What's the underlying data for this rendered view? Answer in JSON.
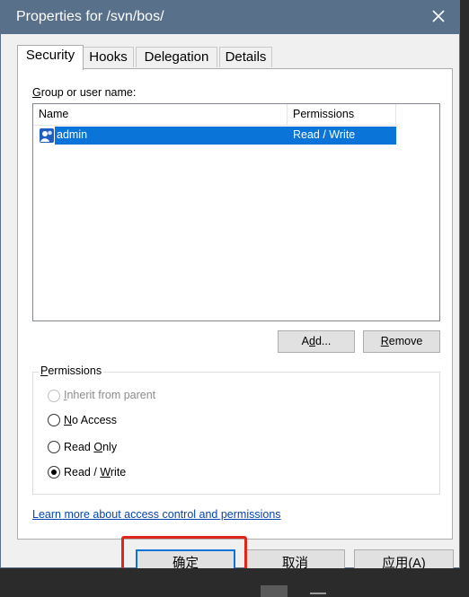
{
  "window": {
    "title": "Properties for /svn/bos/"
  },
  "tabs": [
    {
      "label": "Security",
      "active": true
    },
    {
      "label": "Hooks",
      "active": false
    },
    {
      "label": "Delegation",
      "active": false
    },
    {
      "label": "Details",
      "active": false
    }
  ],
  "security": {
    "group_label_prefix": "",
    "group_label_u": "G",
    "group_label_rest": "roup or user name:",
    "columns": [
      "Name",
      "Permissions"
    ],
    "rows": [
      {
        "name": "admin",
        "permission": "Read / Write",
        "selected": true
      }
    ],
    "add_button": {
      "prefix": "A",
      "u": "d",
      "rest": "d..."
    },
    "remove_button": {
      "prefix": "",
      "u": "R",
      "rest": "emove"
    },
    "permissions_group": {
      "u": "P",
      "rest": "ermissions"
    },
    "options": [
      {
        "prefix": "",
        "u": "I",
        "rest": "nherit from parent",
        "checked": false,
        "disabled": true
      },
      {
        "prefix": "",
        "u": "N",
        "rest": "o Access",
        "checked": false,
        "disabled": false
      },
      {
        "prefix": "Read ",
        "u": "O",
        "rest": "nly",
        "checked": false,
        "disabled": false
      },
      {
        "prefix": "Read / ",
        "u": "W",
        "rest": "rite",
        "checked": true,
        "disabled": false
      }
    ],
    "link": "Learn more about access control and permissions"
  },
  "buttons": {
    "ok": "确定",
    "cancel": "取消",
    "apply": "应用(A)"
  },
  "colors": {
    "titlebar": "#59708a",
    "selection": "#0a74d8",
    "highlight_box": "#e0261b"
  }
}
